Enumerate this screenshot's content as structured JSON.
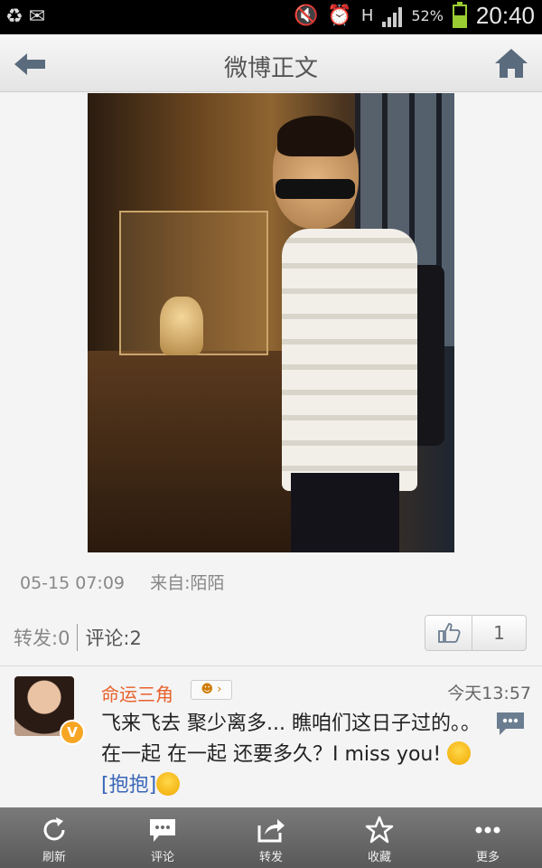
{
  "statusbar": {
    "battery_pct": "52%",
    "battery_level": 0.52,
    "time": "20:40",
    "network": "H",
    "icons": [
      "recycle-icon",
      "mail-icon",
      "mute-icon",
      "alarm-icon",
      "signal-icon"
    ]
  },
  "header": {
    "title": "微博正文",
    "back_icon": "back-arrow-icon",
    "home_icon": "home-icon"
  },
  "post": {
    "photo_icon": "photo-image",
    "date": "05-15 07:09",
    "source": "来自:陌陌",
    "forward": "转发:0",
    "comments": "评论:2",
    "likes": "1"
  },
  "comment": {
    "name": "命运三角",
    "level_badge": "☻ ›",
    "time": "今天13:57",
    "text_before": "飞来飞去 聚少离多... 瞧咱们这日子过的。。在一起 在一起 还要多久？I miss you! ",
    "tag": "[抱抱]",
    "vip_badge": "V"
  },
  "bottombar": {
    "tabs": [
      {
        "label": "刷新",
        "icon": "refresh-icon"
      },
      {
        "label": "评论",
        "icon": "comment-icon"
      },
      {
        "label": "转发",
        "icon": "share-icon"
      },
      {
        "label": "收藏",
        "icon": "star-icon"
      },
      {
        "label": "更多",
        "icon": "more-icon"
      }
    ]
  },
  "colors": {
    "accent_name": "#e8612c",
    "link": "#3a66b8",
    "bar_bg": "#595959"
  }
}
